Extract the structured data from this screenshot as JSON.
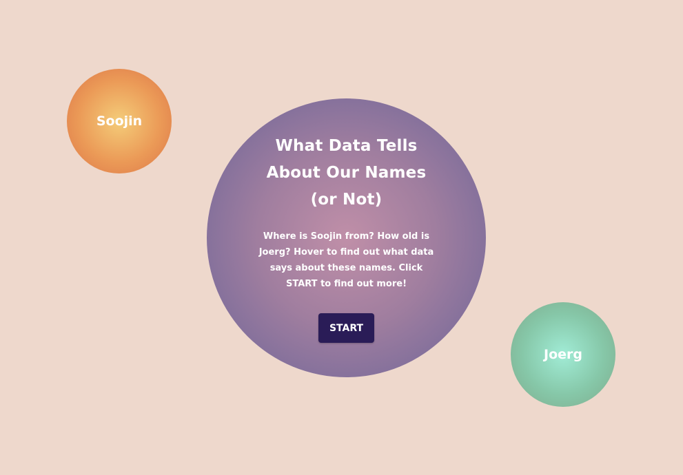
{
  "bubbles": {
    "left_name": "Soojin",
    "right_name": "Joerg"
  },
  "intro": {
    "title": "What Data Tells About Our Names (or Not)",
    "description": "Where is Soojin from? How old is Joerg? Hover to find out what data says about these names. Click START to find out more!",
    "start_label": "START"
  },
  "colors": {
    "background": "#eed8cc",
    "soojin_bubble": "#eb9a57",
    "joerg_bubble": "#86c7a8",
    "center_bubble": "#7d6d9b",
    "start_button": "#2a1c57"
  }
}
